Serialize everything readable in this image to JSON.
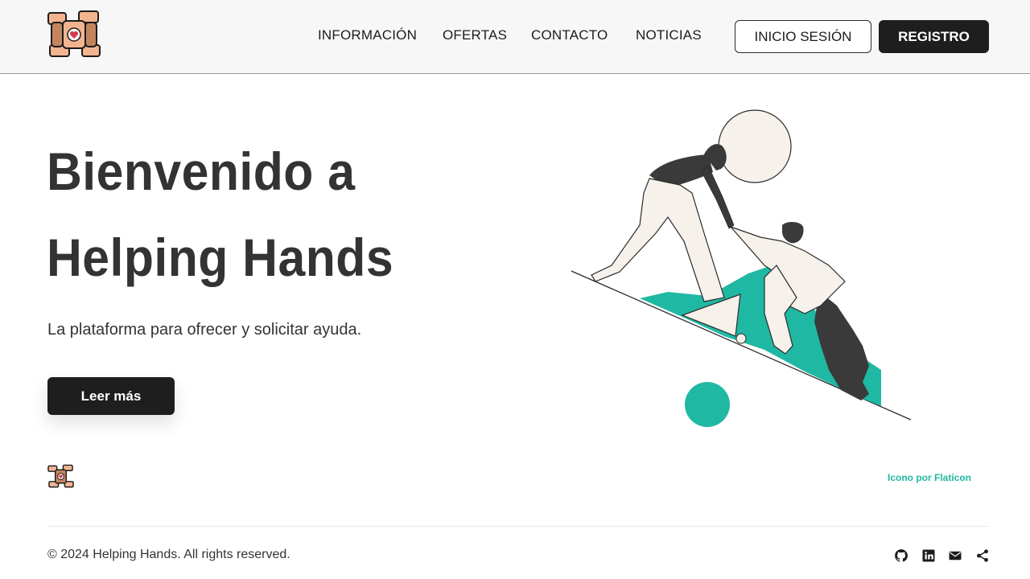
{
  "header": {
    "logo_icon": "helping-hands-logo-icon",
    "nav": [
      {
        "label": "INFORMACIÓN"
      },
      {
        "label": "OFERTAS"
      },
      {
        "label": "CONTACTO"
      },
      {
        "label": "NOTICIAS"
      }
    ],
    "login_label": "INICIO SESIÓN",
    "register_label": "REGISTRO"
  },
  "hero": {
    "title_line1": "Bienvenido a",
    "title_line2": "Helping Hands",
    "subtitle": "La plataforma para ofrecer y solicitar ayuda.",
    "cta_label": "Leer más",
    "illustration_icon": "helping-hand-climb-illustration"
  },
  "credit": {
    "label": "Icono por Flaticon"
  },
  "footer": {
    "copyright": "© 2024 Helping Hands. All rights reserved.",
    "social_icons": [
      "github-icon",
      "linkedin-icon",
      "email-icon",
      "share-icon"
    ]
  },
  "colors": {
    "accent": "#1fb8a3",
    "dark": "#1e1e1e",
    "header_bg": "#f7f7f7",
    "illustration_cream": "#f6f1ea",
    "illustration_dark": "#3a3a3a"
  }
}
